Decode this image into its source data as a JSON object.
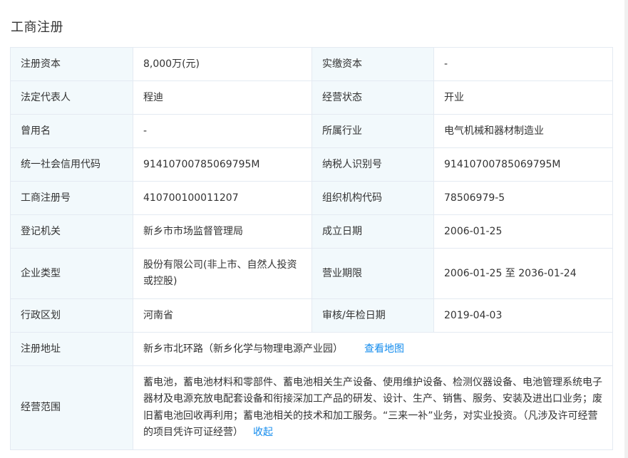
{
  "section_title": "工商注册",
  "rows": [
    {
      "l1": "注册资本",
      "v1": "8,000万(元)",
      "l2": "实缴资本",
      "v2": "-"
    },
    {
      "l1": "法定代表人",
      "v1": "程迪",
      "l2": "经营状态",
      "v2": "开业"
    },
    {
      "l1": "曾用名",
      "v1": "-",
      "l2": "所属行业",
      "v2": "电气机械和器材制造业"
    },
    {
      "l1": "统一社会信用代码",
      "v1": "91410700785069795M",
      "l2": "纳税人识别号",
      "v2": "91410700785069795M"
    },
    {
      "l1": "工商注册号",
      "v1": "410700100011207",
      "l2": "组织机构代码",
      "v2": "78506979-5"
    },
    {
      "l1": "登记机关",
      "v1": "新乡市市场监督管理局",
      "l2": "成立日期",
      "v2": "2006-01-25"
    },
    {
      "l1": "企业类型",
      "v1": "股份有限公司(非上市、自然人投资或控股)",
      "l2": "营业期限",
      "v2": "2006-01-25 至 2036-01-24"
    },
    {
      "l1": "行政区划",
      "v1": "河南省",
      "l2": "审核/年检日期",
      "v2": "2019-04-03"
    }
  ],
  "address": {
    "label": "注册地址",
    "value": "新乡市北环路（新乡化学与物理电源产业园）",
    "link": "查看地图"
  },
  "scope": {
    "label": "经营范围",
    "value": "蓄电池，蓄电池材料和零部件、蓄电池相关生产设备、使用维护设备、检测仪器设备、电池管理系统电子器材及电源充放电配套设备和衔接深加工产品的研发、设计、生产、销售、服务、安装及进出口业务；废旧蓄电池回收再利用；蓄电池相关的技术和加工服务。“三来一补”业务，对实业投资。（凡涉及许可经营的项目凭许可证经营）",
    "link": "收起"
  }
}
